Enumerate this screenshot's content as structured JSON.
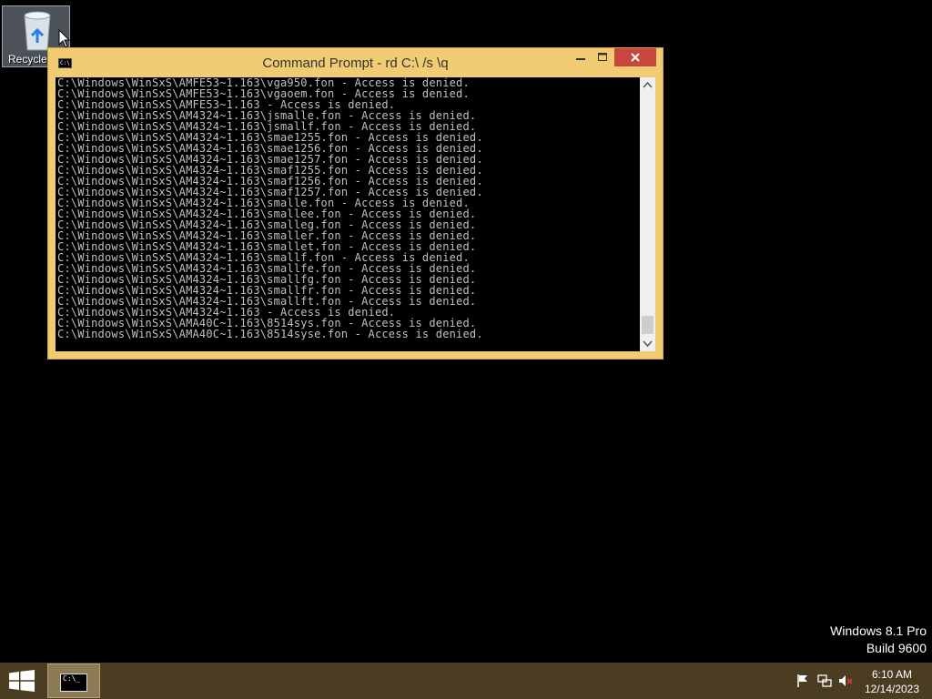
{
  "desktop": {
    "recycle_bin_label": "Recycle"
  },
  "window": {
    "title": "Command Prompt - rd  C:\\ /s \\q",
    "icon_text": "C:\\",
    "console_lines": [
      "C:\\Windows\\WinSxS\\AMFE53~1.163\\vga950.fon - Access is denied.",
      "C:\\Windows\\WinSxS\\AMFE53~1.163\\vgaoem.fon - Access is denied.",
      "C:\\Windows\\WinSxS\\AMFE53~1.163 - Access is denied.",
      "C:\\Windows\\WinSxS\\AM4324~1.163\\jsmalle.fon - Access is denied.",
      "C:\\Windows\\WinSxS\\AM4324~1.163\\jsmallf.fon - Access is denied.",
      "C:\\Windows\\WinSxS\\AM4324~1.163\\smae1255.fon - Access is denied.",
      "C:\\Windows\\WinSxS\\AM4324~1.163\\smae1256.fon - Access is denied.",
      "C:\\Windows\\WinSxS\\AM4324~1.163\\smae1257.fon - Access is denied.",
      "C:\\Windows\\WinSxS\\AM4324~1.163\\smaf1255.fon - Access is denied.",
      "C:\\Windows\\WinSxS\\AM4324~1.163\\smaf1256.fon - Access is denied.",
      "C:\\Windows\\WinSxS\\AM4324~1.163\\smaf1257.fon - Access is denied.",
      "C:\\Windows\\WinSxS\\AM4324~1.163\\smalle.fon - Access is denied.",
      "C:\\Windows\\WinSxS\\AM4324~1.163\\smallee.fon - Access is denied.",
      "C:\\Windows\\WinSxS\\AM4324~1.163\\smalleg.fon - Access is denied.",
      "C:\\Windows\\WinSxS\\AM4324~1.163\\smaller.fon - Access is denied.",
      "C:\\Windows\\WinSxS\\AM4324~1.163\\smallet.fon - Access is denied.",
      "C:\\Windows\\WinSxS\\AM4324~1.163\\smallf.fon - Access is denied.",
      "C:\\Windows\\WinSxS\\AM4324~1.163\\smallfe.fon - Access is denied.",
      "C:\\Windows\\WinSxS\\AM4324~1.163\\smallfg.fon - Access is denied.",
      "C:\\Windows\\WinSxS\\AM4324~1.163\\smallfr.fon - Access is denied.",
      "C:\\Windows\\WinSxS\\AM4324~1.163\\smallft.fon - Access is denied.",
      "C:\\Windows\\WinSxS\\AM4324~1.163 - Access is denied.",
      "C:\\Windows\\WinSxS\\AMA40C~1.163\\8514sys.fon - Access is denied.",
      "C:\\Windows\\WinSxS\\AMA40C~1.163\\8514syse.fon - Access is denied."
    ]
  },
  "watermark": {
    "line1": "Windows 8.1 Pro",
    "line2": "Build 9600"
  },
  "taskbar": {
    "task_icon_text": "C:\\_",
    "clock_time": "6:10 AM",
    "clock_date": "12/14/2023"
  },
  "colors": {
    "window_frame": "#f2cc72",
    "close_button": "#c7473e",
    "taskbar": "#4a3d22",
    "console_text": "#c0c0c0"
  }
}
